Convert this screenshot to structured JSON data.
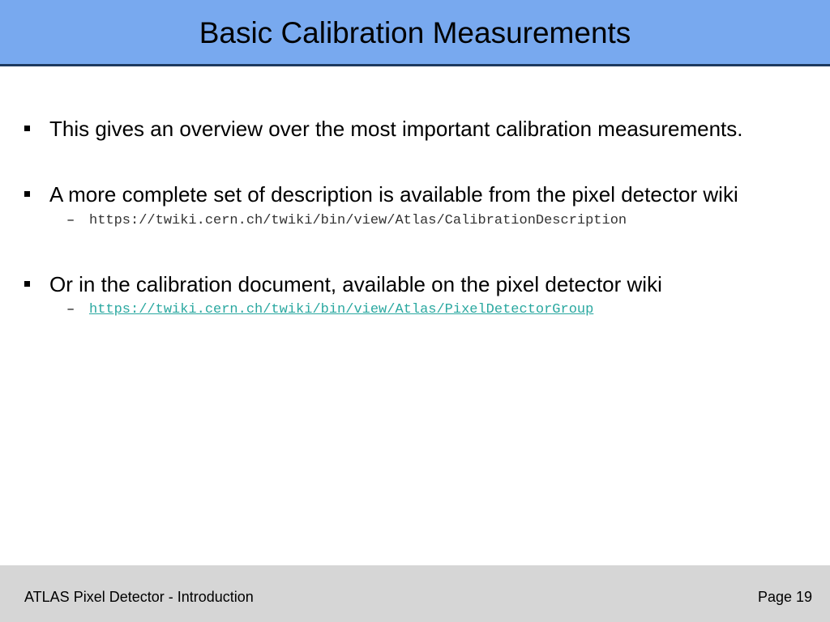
{
  "header": {
    "title": "Basic Calibration Measurements"
  },
  "bullets": [
    {
      "text": "This gives an overview over the most important calibration measurements."
    },
    {
      "text": "A more complete set of description is available from the pixel detector wiki",
      "sub": [
        {
          "dash": "–",
          "text": "https://twiki.cern.ch/twiki/bin/view/Atlas/CalibrationDescription"
        }
      ]
    },
    {
      "text": "Or in the calibration document, available on the pixel detector wiki",
      "sub": [
        {
          "dash": "–",
          "text": "https://twiki.cern.ch/twiki/bin/view/Atlas/PixelDetectorGroup"
        }
      ]
    }
  ],
  "footer": {
    "left": "ATLAS Pixel Detector - Introduction",
    "right": "Page 19"
  },
  "colors": {
    "title_bar": "#78a9ef",
    "title_border": "#1e3a5f",
    "link": "#2aa8a0",
    "footer_bg": "#d6d6d6"
  }
}
